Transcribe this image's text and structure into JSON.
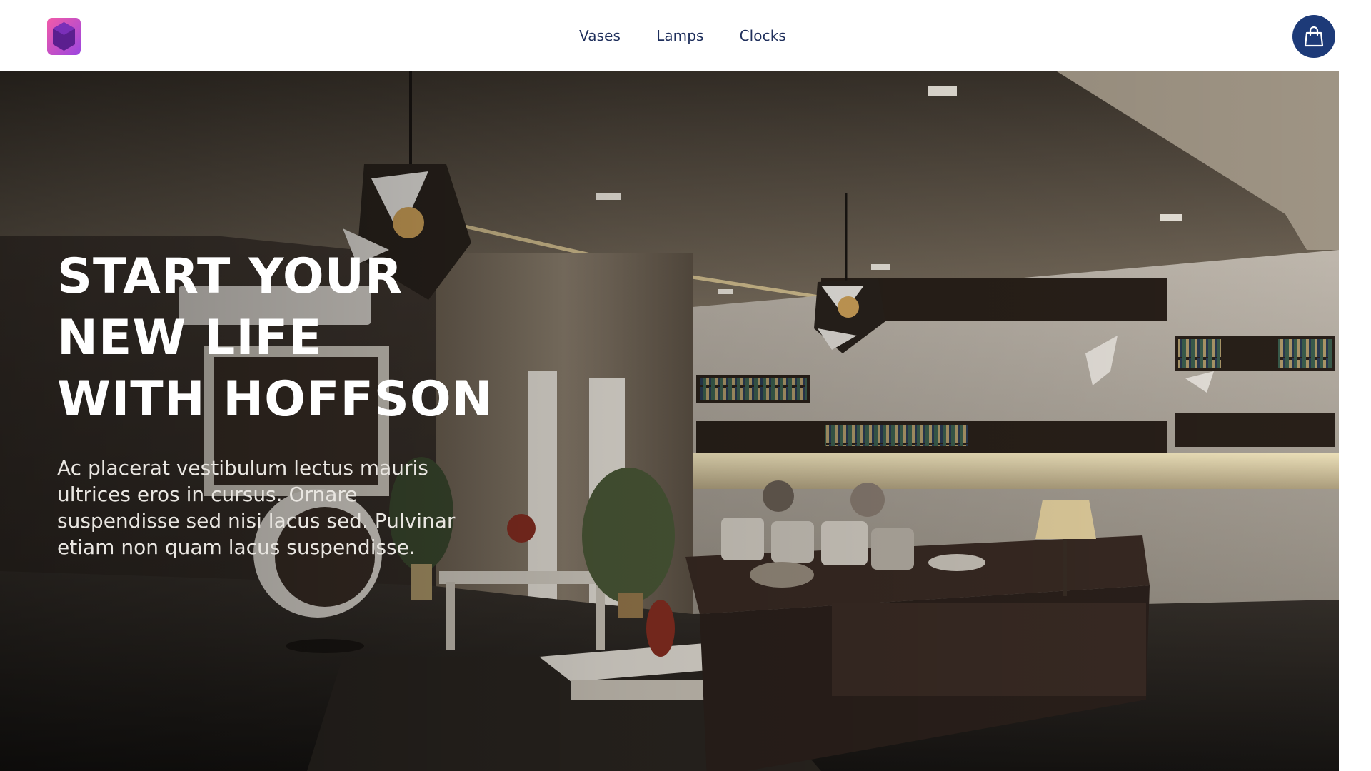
{
  "header": {
    "logo_icon": "hexagon-logo-icon",
    "nav": [
      {
        "label": "Vases"
      },
      {
        "label": "Lamps"
      },
      {
        "label": "Clocks"
      }
    ],
    "cart_icon": "shopping-bag-icon"
  },
  "hero": {
    "title_lines": [
      "START YOUR",
      "NEW LIFE",
      "WITH HOFFSON"
    ],
    "description": "Ac placerat vestibulum lectus mauris ultrices eros in cursus. Ornare suspendisse sed nisi lacus sed. Pulvinar etiam non quam lacus suspendisse.",
    "background_image": "living-room-interior-photo"
  },
  "colors": {
    "nav_text": "#1f2f5c",
    "cart_bg": "#1d3a78",
    "logo_gradient_start": "#e64fa0",
    "logo_gradient_end": "#8b3fd6"
  }
}
